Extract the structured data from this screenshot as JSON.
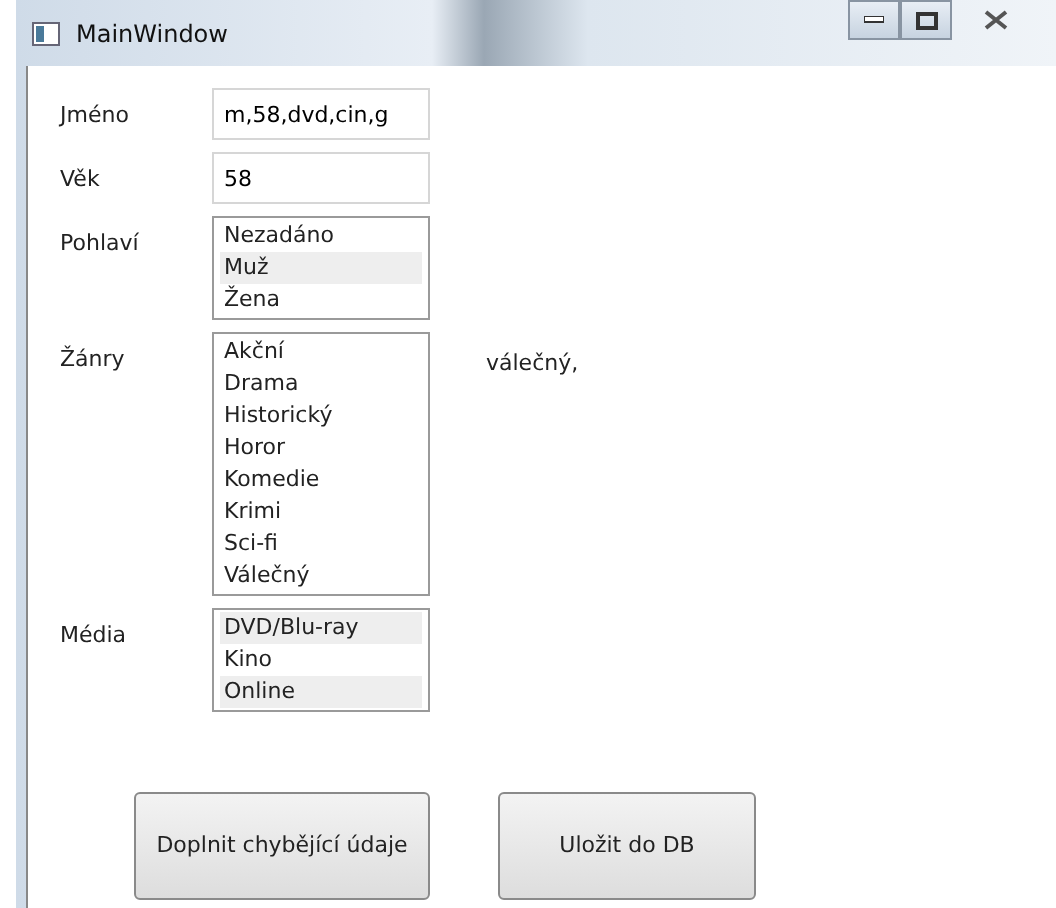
{
  "window": {
    "title": "MainWindow"
  },
  "name_field": {
    "label": "Jméno",
    "value": "m,58,dvd,cin,g"
  },
  "age_field": {
    "label": "Věk",
    "value": "58"
  },
  "gender": {
    "label": "Pohlaví",
    "items": [
      {
        "text": "Nezadáno",
        "selected": false
      },
      {
        "text": "Muž",
        "selected": true
      },
      {
        "text": "Žena",
        "selected": false
      }
    ]
  },
  "genres": {
    "label": "Žánry",
    "items": [
      {
        "text": "Akční",
        "selected": false
      },
      {
        "text": "Drama",
        "selected": false
      },
      {
        "text": "Historický",
        "selected": false
      },
      {
        "text": "Horor",
        "selected": false
      },
      {
        "text": "Komedie",
        "selected": false
      },
      {
        "text": "Krimi",
        "selected": false
      },
      {
        "text": "Sci-fi",
        "selected": false
      },
      {
        "text": "Válečný",
        "selected": false
      }
    ],
    "summary": "válečný,"
  },
  "media": {
    "label": "Média",
    "items": [
      {
        "text": "DVD/Blu-ray",
        "selected": true
      },
      {
        "text": "Kino",
        "selected": false
      },
      {
        "text": "Online",
        "selected": true
      }
    ]
  },
  "buttons": [
    "Doplnit chybějící údaje",
    "Uložit do DB"
  ]
}
